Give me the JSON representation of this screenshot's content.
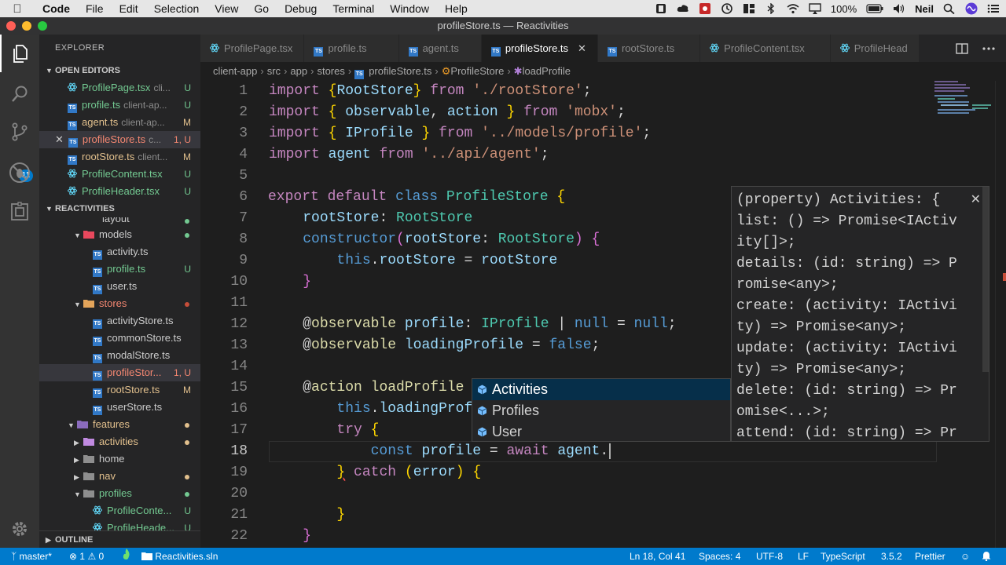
{
  "menubar": {
    "app_name": "Code",
    "items": [
      "File",
      "Edit",
      "Selection",
      "View",
      "Go",
      "Debug",
      "Terminal",
      "Window",
      "Help"
    ],
    "battery": "100%",
    "user": "Neil"
  },
  "window": {
    "title": "profileStore.ts — Reactivities"
  },
  "activity": {
    "scm_badge": "11"
  },
  "sidebar": {
    "title": "EXPLORER",
    "open_editors_title": "OPEN EDITORS",
    "open_editors": [
      {
        "name": "ProfilePage.tsx",
        "sub": "cli...",
        "status": "U"
      },
      {
        "name": "profile.ts",
        "sub": "client-ap...",
        "status": "U"
      },
      {
        "name": "agent.ts",
        "sub": "client-ap...",
        "status": "M"
      },
      {
        "name": "profileStore.ts",
        "sub": "c...",
        "status": "1, U"
      },
      {
        "name": "rootStore.ts",
        "sub": "client...",
        "status": "M"
      },
      {
        "name": "ProfileContent.tsx",
        "sub": "",
        "status": "U"
      },
      {
        "name": "ProfileHeader.tsx",
        "sub": "",
        "status": "U"
      }
    ],
    "project_title": "REACTIVITIES",
    "tree": {
      "layout": "layout",
      "models": "models",
      "activity_ts": "activity.ts",
      "profile_ts": "profile.ts",
      "profile_ts_status": "U",
      "user_ts": "user.ts",
      "stores": "stores",
      "activityStore": "activityStore.ts",
      "commonStore": "commonStore.ts",
      "modalStore": "modalStore.ts",
      "profileStore": "profileStor...",
      "profileStore_status": "1, U",
      "rootStore": "rootStore.ts",
      "rootStore_status": "M",
      "userStore": "userStore.ts",
      "features": "features",
      "activities": "activities",
      "home": "home",
      "nav": "nav",
      "profiles": "profiles",
      "profileContent": "ProfileConte...",
      "profileContent_status": "U",
      "profileHeader": "ProfileHeade...",
      "profileHeader_status": "U"
    },
    "outline_title": "OUTLINE"
  },
  "tabs": [
    "ProfilePage.tsx",
    "profile.ts",
    "agent.ts",
    "profileStore.ts",
    "rootStore.ts",
    "ProfileContent.tsx",
    "ProfileHead"
  ],
  "active_tab": "profileStore.ts",
  "breadcrumb": [
    "client-app",
    "src",
    "app",
    "stores",
    "profileStore.ts",
    "ProfileStore",
    "loadProfile"
  ],
  "suggestions": [
    "Activities",
    "Profiles",
    "User"
  ],
  "detail_lines": [
    "(property) Activities: {",
    "list: () => Promise<IActiv",
    "ity[]>;",
    "details: (id: string) => P",
    "romise<any>;",
    "create: (activity: IActivi",
    "ty) => Promise<any>;",
    "update: (activity: IActivi",
    "ty) => Promise<any>;",
    "delete: (id: string) => Pr",
    "omise<...>;",
    "attend: (id: string) => Pr"
  ],
  "statusbar": {
    "branch": "master*",
    "errors": "1",
    "warnings": "0",
    "solution": "Reactivities.sln",
    "position": "Ln 18, Col 41",
    "spaces": "Spaces: 4",
    "encoding": "UTF-8",
    "eol": "LF",
    "language": "TypeScript",
    "version": "3.5.2",
    "formatter": "Prettier"
  },
  "colors": {
    "accent": "#007acc",
    "modified": "#e2c08d",
    "untracked": "#73c991",
    "error": "#f48771"
  }
}
